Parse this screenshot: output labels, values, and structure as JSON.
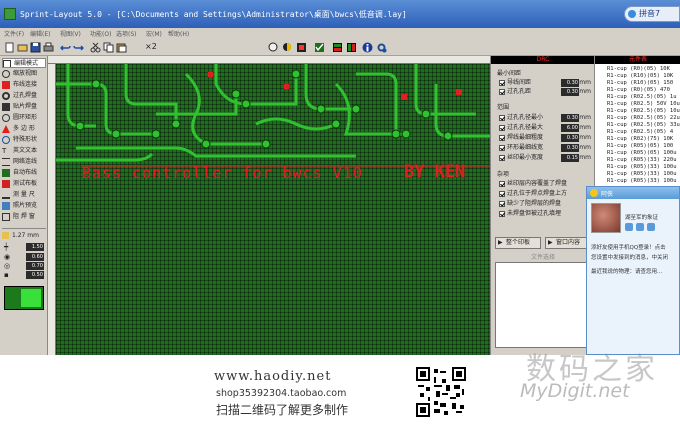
{
  "window": {
    "title": "Sprint-Layout 5.0 - [C:\\Documents and Settings\\Administrator\\桌面\\bwcs\\低音调.lay]",
    "ime_label": "拼音7"
  },
  "menu": [
    "文件(F)",
    "编辑(E)",
    "视图(V)",
    "功能(O)",
    "选项(S)",
    "宏(M)",
    "帮助(H)"
  ],
  "toolbar_icons": [
    "new-icon",
    "open-icon",
    "save-icon",
    "print-icon",
    "undo-icon",
    "redo-icon",
    "cut-icon",
    "copy-icon",
    "paste-icon",
    "delete-icon",
    "grid-icon",
    "zoom-icon",
    "search-icon",
    "drc-icon",
    "layer-icon",
    "info-icon",
    "settings-icon"
  ],
  "toolbar": {
    "zoom_label": "×2"
  },
  "tools": [
    "编辑模式",
    "缩放视图",
    "布线连接",
    "过孔焊盘",
    "贴片焊盘",
    "圆环矩形",
    "多 边 形",
    "特殊形状",
    "英文文本",
    "网络连线",
    "自动布线",
    "测试布板",
    "测 量 尺",
    "照片预览",
    "阻 焊 窗"
  ],
  "grid_label": "1.27 mm",
  "params": [
    "1.50",
    "0.60",
    "0.70",
    "0.50"
  ],
  "pcb": {
    "silk_text": "Bass controller for bwcs V10",
    "silk_text2": "BY KEN"
  },
  "drc": {
    "header": "DRC",
    "min_spacing_title": "最小间距",
    "spacing_rows": [
      {
        "label": "导线间距",
        "value": "0.30",
        "unit": "mm",
        "checked": true
      },
      {
        "label": "过孔孔距",
        "value": "0.30",
        "unit": "mm",
        "checked": true
      }
    ],
    "range_title": "范围",
    "range_rows": [
      {
        "label": "过孔孔径最小",
        "value": "0.30",
        "unit": "mm",
        "checked": true
      },
      {
        "label": "过孔孔径最大",
        "value": "6.00",
        "unit": "mm",
        "checked": true
      },
      {
        "label": "焊线最细粗度",
        "value": "0.30",
        "unit": "mm",
        "checked": true
      },
      {
        "label": "环形最细线宽",
        "value": "0.30",
        "unit": "mm",
        "checked": true
      },
      {
        "label": "丝印最小宽度",
        "value": "0.15",
        "unit": "mm",
        "checked": true
      }
    ],
    "misc_title": "杂项",
    "misc_rows": [
      {
        "label": "丝印层内容覆盖了焊盘",
        "checked": true
      },
      {
        "label": "过孔位于焊点焊盘上方",
        "checked": true
      },
      {
        "label": "缺少了阻焊层的焊盘",
        "checked": true
      },
      {
        "label": "未焊盘但被过孔填埋",
        "checked": true
      }
    ],
    "check_btn": "整个印板",
    "window_btn": "窗口内容",
    "notes_header": "文件选择"
  },
  "components": {
    "header": "元件表",
    "items": [
      "R1-cup  (R0)(05) 10K",
      "R1-cup  (R10)(05) 10K",
      "R1-cup  (R10)(05) 150",
      "R1-cup  (R0)(05) 470",
      "R1-cup  (R02.5)(05) 1u",
      "R1-cup  (R02.5) 50V 10u",
      "R1-cup  (R02.5)(05) 10u",
      "R1-cup  (R02.5)(05) 22u",
      "R1-cup  (R02.5)(05) 33u",
      "R1-cup  (R02.5)(05) 4",
      "R1-cup  (R02)(75) 10K",
      "R1-cup  (R05)(05) 100",
      "R1-cup  (R05)(05) 100u",
      "R1-cup  (R05)(33) 220u",
      "R1-cup  (R05)(33) 100u",
      "R1-cup  (R05)(33) 100u",
      "R1-cup  (R05)(33) 100u"
    ]
  },
  "qq": {
    "title": "阿侠",
    "name_label": "湖至军的象证",
    "lines": [
      "添好友使用手机QQ登录！点击",
      "您设置中发接到的消息，中关闭",
      "最近我说的物理：请查您用..."
    ]
  },
  "banner": {
    "url": "www.haodiy.net",
    "shop": "shop35392304.taobao.com",
    "scan": "扫描二维码了解更多制作"
  },
  "watermark": {
    "cn": "数码之家",
    "en": "MyDigit.net"
  }
}
